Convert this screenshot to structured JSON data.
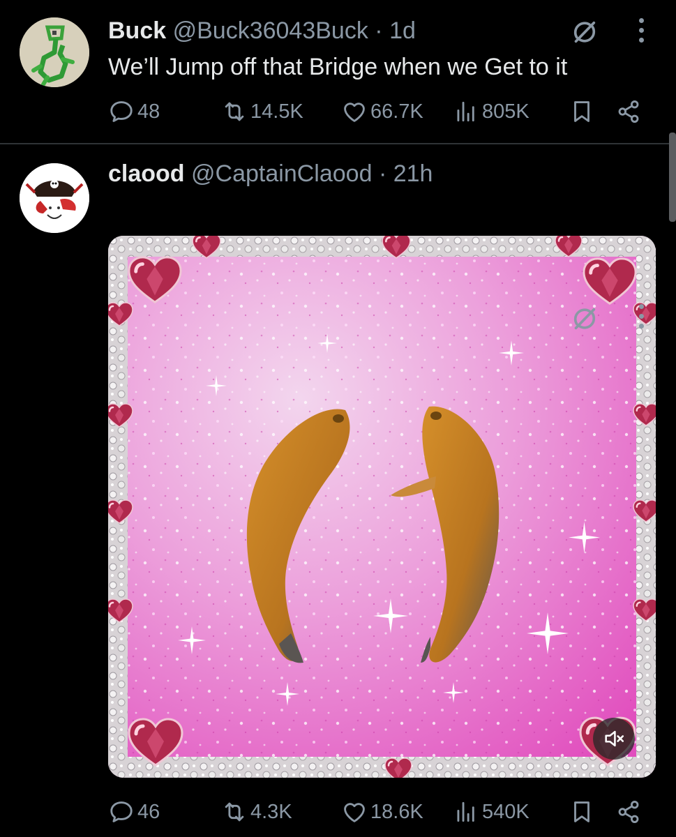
{
  "tweets": [
    {
      "display_name": "Buck",
      "handle": "@Buck36043Buck",
      "separator": "·",
      "time": "1d",
      "text": "We’ll Jump off that Bridge when we Get to it",
      "replies": "48",
      "reposts": "14.5K",
      "likes": "66.7K",
      "views": "805K",
      "avatar_icon": "green-crayon-drawing-avatar"
    },
    {
      "display_name": "claood",
      "handle": "@CaptainClaood",
      "separator": "·",
      "time": "21h",
      "text": "",
      "replies": "46",
      "reposts": "4.3K",
      "likes": "18.6K",
      "views": "540K",
      "avatar_icon": "pirate-skull-claw-avatar",
      "media": {
        "type": "video",
        "description_icon": "glitter-hearts-frame-with-two-fish",
        "muted": true
      }
    }
  ],
  "icons": {
    "reply": "speech-bubble-icon",
    "repost": "repost-arrows-icon",
    "like": "heart-icon",
    "views": "bar-chart-icon",
    "bookmark": "bookmark-icon",
    "share": "share-icon",
    "grok": "grok-slash-icon",
    "more": "vertical-ellipsis-icon",
    "mute": "speaker-muted-icon"
  },
  "colors": {
    "background": "#000000",
    "text_primary": "#e7e9ea",
    "text_secondary": "#8b98a5",
    "divider": "#2f3336",
    "glitter_pink": "#e86cc6"
  }
}
